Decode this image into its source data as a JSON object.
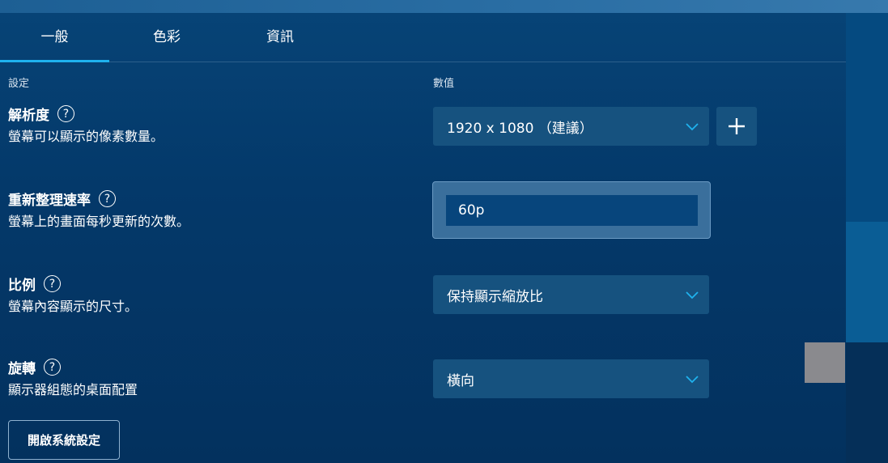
{
  "tabs": [
    {
      "label": "一般",
      "active": true
    },
    {
      "label": "色彩",
      "active": false
    },
    {
      "label": "資訊",
      "active": false
    }
  ],
  "columns": {
    "setting": "設定",
    "value": "數值"
  },
  "settings": {
    "resolution": {
      "title": "解析度",
      "help": "?",
      "desc": "螢幕可以顯示的像素數量。",
      "value": "1920 x 1080 （建議）",
      "add_icon": "plus-icon"
    },
    "refresh": {
      "title": "重新整理速率",
      "help": "?",
      "desc": "螢幕上的畫面每秒更新的次數。",
      "value": "60p"
    },
    "scale": {
      "title": "比例",
      "help": "?",
      "desc": "螢幕內容顯示的尺寸。",
      "value": "保持顯示縮放比"
    },
    "rotation": {
      "title": "旋轉",
      "help": "?",
      "desc": "顯示器組態的桌面配置",
      "value": "橫向"
    }
  },
  "system_button": "開啟系統設定",
  "colors": {
    "accent": "#1fb2ee",
    "control_bg": "#16527f",
    "background": "#04396a"
  }
}
